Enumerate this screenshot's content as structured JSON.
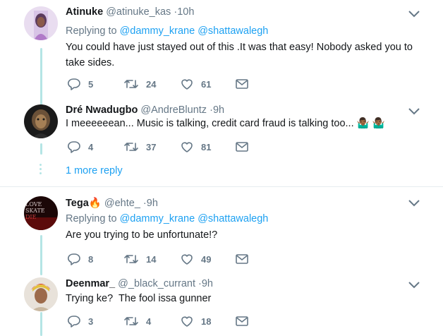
{
  "tweets": [
    {
      "name": "Atinuke",
      "handle": "@atinuke_kas",
      "time": "10h",
      "replying_label": "Replying to",
      "replying_to": [
        "@dammy_krane",
        "@shattawalegh"
      ],
      "text": "You could have just stayed out of this .It was that easy! Nobody asked you to take sides.",
      "replies": "5",
      "retweets": "24",
      "likes": "61"
    },
    {
      "name": "Dré Nwadugbo",
      "handle": "@AndreBluntz",
      "time": "9h",
      "text": "I meeeeeean... Music is talking, credit card fraud is talking too...",
      "emoji": "🤷🏾‍♂️ 🤷🏾‍♂️",
      "replies": "4",
      "retweets": "37",
      "likes": "81"
    },
    {
      "name": "Tega",
      "name_emoji": "🔥",
      "handle": "@ehte_",
      "time": "9h",
      "avatar_text": "LOVE SKATE DIE",
      "replying_label": "Replying to",
      "replying_to": [
        "@dammy_krane",
        "@shattawalegh"
      ],
      "text": "Are you trying to be unfortunate!?",
      "replies": "8",
      "retweets": "14",
      "likes": "49"
    },
    {
      "name": "Deenmar_",
      "handle": "@_black_currant",
      "time": "9h",
      "text": "Trying ke?  The fool issa gunner",
      "replies": "3",
      "retweets": "4",
      "likes": "18"
    }
  ],
  "more_replies": "1 more reply",
  "colors": {
    "accent": "#1da1f2",
    "muted": "#657786",
    "thread_line": "#b5e5e5",
    "divider": "#e6ecf0"
  },
  "icons": [
    "chevron-down-icon",
    "reply-icon",
    "retweet-icon",
    "like-icon",
    "message-icon"
  ]
}
